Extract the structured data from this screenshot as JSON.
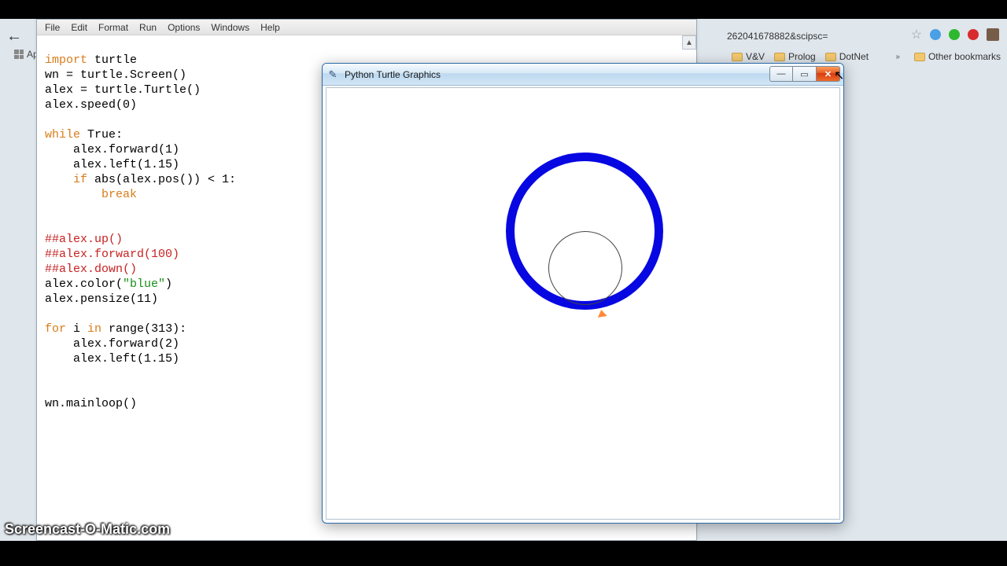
{
  "browser": {
    "address_fragment": "262041678882&scipsc=",
    "bookmarks": [
      "V&V",
      "Prolog",
      "DotNet"
    ],
    "other_bookmarks_label": "Other bookmarks",
    "apps_label": "Apps"
  },
  "editor": {
    "menu": [
      "File",
      "Edit",
      "Format",
      "Run",
      "Options",
      "Windows",
      "Help"
    ],
    "code": {
      "l1a": "import",
      "l1b": " turtle",
      "l2": "wn = turtle.Screen()",
      "l3": "alex = turtle.Turtle()",
      "l4": "alex.speed(0)",
      "l5": "",
      "l6a": "while",
      "l6b": " True",
      "l6c": ":",
      "l7": "    alex.forward(1)",
      "l8": "    alex.left(1.15)",
      "l9a": "    ",
      "l9b": "if",
      "l9c": " abs(alex.pos()) < 1:",
      "l10a": "        ",
      "l10b": "break",
      "l11": "",
      "l12": "",
      "l13": "##alex.up()",
      "l14": "##alex.forward(100)",
      "l15": "##alex.down()",
      "l16a": "alex.color(",
      "l16b": "\"blue\"",
      "l16c": ")",
      "l17": "alex.pensize(11)",
      "l18": "",
      "l19a": "for",
      "l19b": " i ",
      "l19c": "in",
      "l19d": " range",
      "l19e": "(313):",
      "l20": "    alex.forward(2)",
      "l21": "    alex.left(1.15)",
      "l22": "",
      "l23": "",
      "l24": "wn.mainloop()"
    }
  },
  "turtle_window": {
    "title": "Python Turtle Graphics"
  },
  "watermark": "Screencast-O-Matic.com"
}
